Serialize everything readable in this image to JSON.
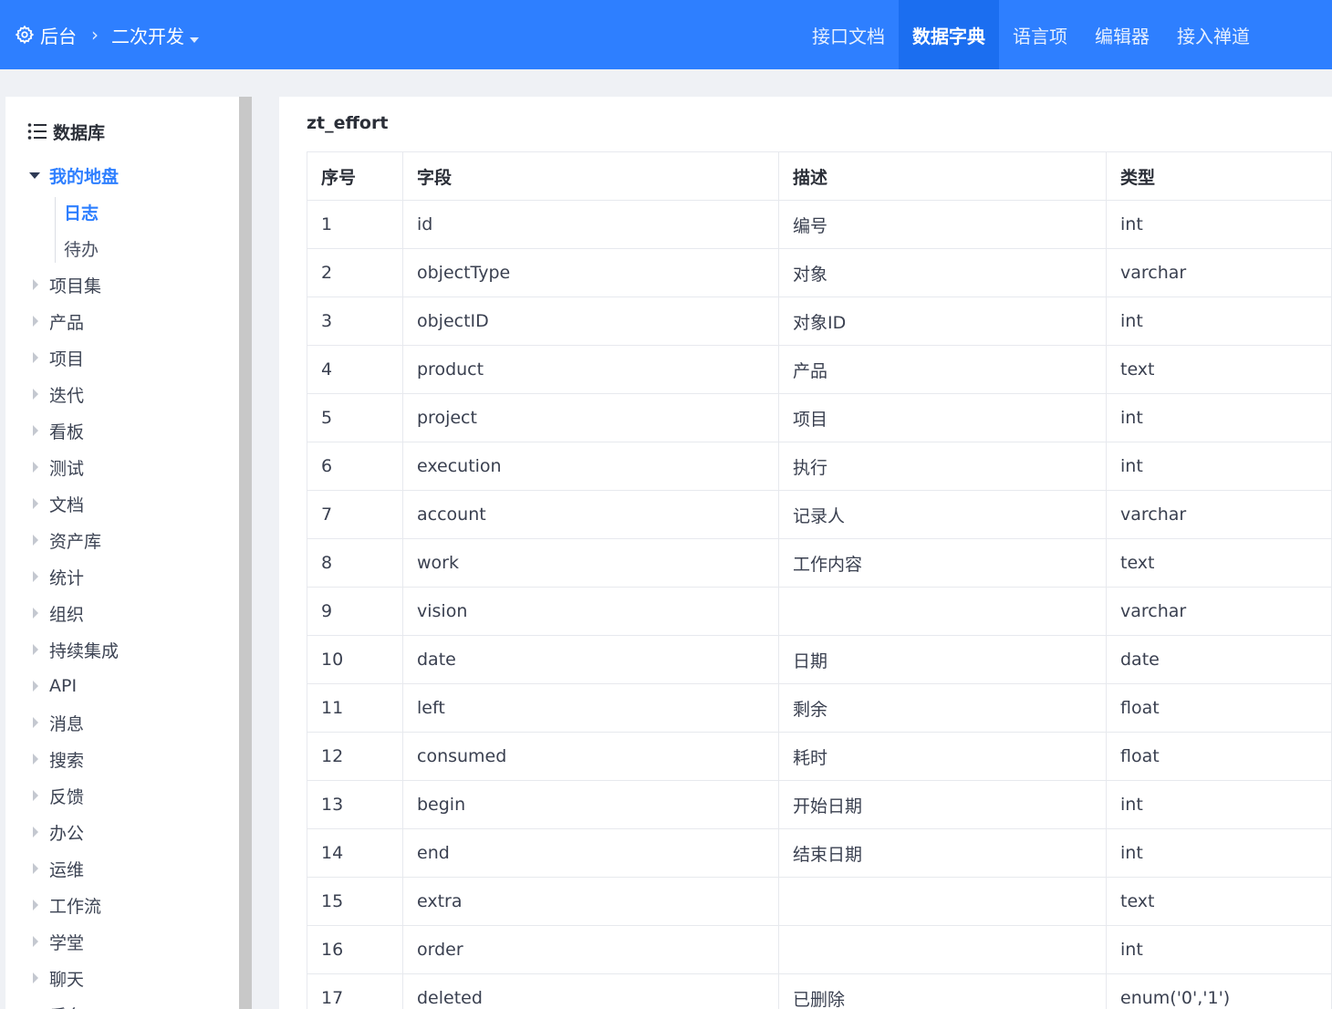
{
  "header": {
    "home_label": "后台",
    "section_label": "二次开发",
    "tabs": [
      {
        "label": "接口文档",
        "active": false
      },
      {
        "label": "数据字典",
        "active": true
      },
      {
        "label": "语言项",
        "active": false
      },
      {
        "label": "编辑器",
        "active": false
      },
      {
        "label": "接入禅道",
        "active": false
      }
    ]
  },
  "sidebar": {
    "title": "数据库",
    "open_group": {
      "label": "我的地盘",
      "children": [
        {
          "label": "日志",
          "active": true
        },
        {
          "label": "待办",
          "active": false
        }
      ]
    },
    "groups": [
      "项目集",
      "产品",
      "项目",
      "迭代",
      "看板",
      "测试",
      "文档",
      "资产库",
      "统计",
      "组织",
      "持续集成",
      "API",
      "消息",
      "搜索",
      "反馈",
      "办公",
      "运维",
      "工作流",
      "学堂",
      "聊天",
      "后台"
    ]
  },
  "table": {
    "name": "zt_effort",
    "columns": [
      "序号",
      "字段",
      "描述",
      "类型"
    ],
    "rows": [
      [
        "1",
        "id",
        "编号",
        "int"
      ],
      [
        "2",
        "objectType",
        "对象",
        "varchar"
      ],
      [
        "3",
        "objectID",
        "对象ID",
        "int"
      ],
      [
        "4",
        "product",
        "产品",
        "text"
      ],
      [
        "5",
        "project",
        "项目",
        "int"
      ],
      [
        "6",
        "execution",
        "执行",
        "int"
      ],
      [
        "7",
        "account",
        "记录人",
        "varchar"
      ],
      [
        "8",
        "work",
        "工作内容",
        "text"
      ],
      [
        "9",
        "vision",
        "",
        "varchar"
      ],
      [
        "10",
        "date",
        "日期",
        "date"
      ],
      [
        "11",
        "left",
        "剩余",
        "float"
      ],
      [
        "12",
        "consumed",
        "耗时",
        "float"
      ],
      [
        "13",
        "begin",
        "开始日期",
        "int"
      ],
      [
        "14",
        "end",
        "结束日期",
        "int"
      ],
      [
        "15",
        "extra",
        "",
        "text"
      ],
      [
        "16",
        "order",
        "",
        "int"
      ],
      [
        "17",
        "deleted",
        "已删除",
        "enum('0','1')"
      ]
    ]
  },
  "colors": {
    "primary": "#2e7fff",
    "active_tab": "#1b6ef0"
  },
  "icons": {
    "home": "gear-icon",
    "breadcrumb_sep": "chevron-right-icon",
    "sidebar_title": "list-icon"
  }
}
